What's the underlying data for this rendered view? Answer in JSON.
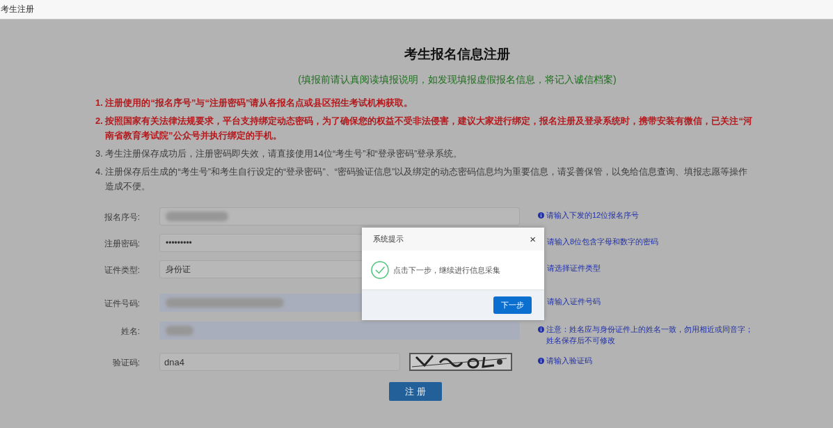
{
  "window": {
    "title": "考生注册"
  },
  "page": {
    "title": "考生报名信息注册",
    "subtitle": "(填报前请认真阅读填报说明，如发现填报虚假报名信息，将记入诚信档案)"
  },
  "notices": [
    {
      "kind": "important",
      "text": "1. 注册使用的“报名序号”与“注册密码”请从各报名点或县区招生考试机构获取。"
    },
    {
      "kind": "important",
      "text": "2. 按照国家有关法律法规要求，平台支持绑定动态密码，为了确保您的权益不受非法侵害，建议大家进行绑定，报名注册及登录系统时，携带安装有微信，已关注“河南省教育考试院”公众号并执行绑定的手机。"
    },
    {
      "kind": "normal",
      "text": "3. 考生注册保存成功后，注册密码即失效，请直接使用14位“考生号”和“登录密码”登录系统。"
    },
    {
      "kind": "normal",
      "text": "4. 注册保存后生成的“考生号”和考生自行设定的“登录密码”、“密码验证信息”以及绑定的动态密码信息均为重要信息，请妥善保管，以免给信息查询、填报志愿等操作造成不便。"
    }
  ],
  "form": [
    {
      "label": "报名序号:",
      "kind": "blurred",
      "autofilled": false,
      "hint": "请输入下发的12位报名序号",
      "hint_icon": true
    },
    {
      "label": "注册密码:",
      "kind": "text",
      "value": "•••••••••",
      "autofilled": false,
      "hint": "请输入8位包含字母和数字的密码",
      "hint_icon": false
    },
    {
      "label": "证件类型:",
      "kind": "text",
      "value": "身份证",
      "autofilled": false,
      "hint": "请选择证件类型",
      "hint_icon": false
    },
    {
      "label": "证件号码:",
      "kind": "blurred",
      "autofilled": true,
      "hint": "请输入证件号码",
      "hint_icon": false
    },
    {
      "label": "姓名:",
      "kind": "blurred",
      "autofilled": true,
      "hint": "注意：姓名应与身份证件上的姓名一致，勿用相近或同音字；姓名保存后不可修改",
      "hint_icon": true
    },
    {
      "label": "验证码:",
      "kind": "captcha",
      "value": "dna4",
      "autofilled": false,
      "hint": "请输入验证码",
      "hint_icon": true
    }
  ],
  "register_button": "注 册",
  "dialog": {
    "title": "系统提示",
    "close": "×",
    "message": "点击下一步，继续进行信息采集",
    "button": "下一步"
  }
}
